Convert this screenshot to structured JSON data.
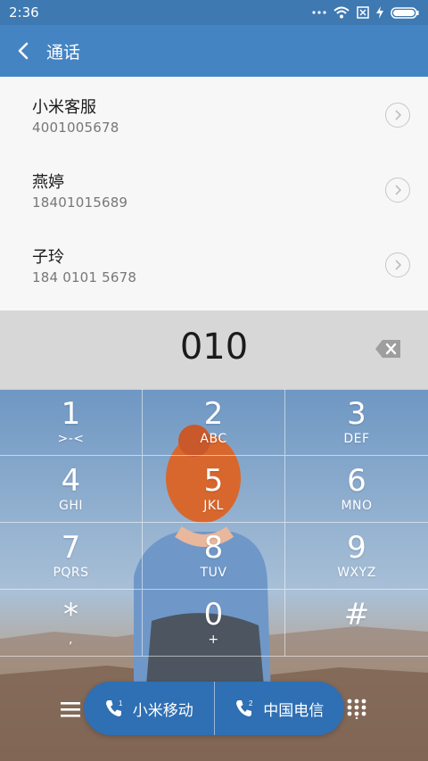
{
  "status": {
    "time": "2:36"
  },
  "header": {
    "title": "通话"
  },
  "results": [
    {
      "name": "小米客服",
      "number": "4001005678"
    },
    {
      "name": "燕婷",
      "number": "18401015689"
    },
    {
      "name": "子玲",
      "number": "184 0101 5678"
    }
  ],
  "input": {
    "digits": "010"
  },
  "keypad": [
    {
      "digit": "1",
      "letters": ">-<"
    },
    {
      "digit": "2",
      "letters": "ABC"
    },
    {
      "digit": "3",
      "letters": "DEF"
    },
    {
      "digit": "4",
      "letters": "GHI"
    },
    {
      "digit": "5",
      "letters": "JKL"
    },
    {
      "digit": "6",
      "letters": "MNO"
    },
    {
      "digit": "7",
      "letters": "PQRS"
    },
    {
      "digit": "8",
      "letters": "TUV"
    },
    {
      "digit": "9",
      "letters": "WXYZ"
    },
    {
      "digit": "*",
      "letters": ","
    },
    {
      "digit": "0",
      "letters": "+"
    },
    {
      "digit": "#",
      "letters": ""
    }
  ],
  "sims": [
    {
      "label": "小米移动",
      "slot": "1"
    },
    {
      "label": "中国电信",
      "slot": "2"
    }
  ],
  "icons": {
    "back": "chevron-left-icon",
    "menu": "hamburger-menu-icon",
    "dialpad": "dialpad-icon",
    "wifi": "wifi-icon",
    "battery": "battery-icon",
    "backspace": "backspace-icon"
  },
  "colors": {
    "header": "#4584c3",
    "statusbar": "#3f79b2",
    "sim_button": "#2f6fb4"
  }
}
